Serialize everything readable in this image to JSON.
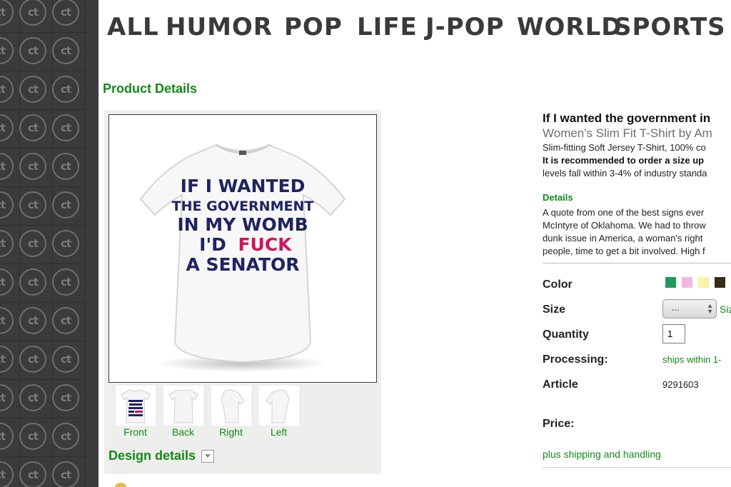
{
  "nav": {
    "items": [
      "ALL",
      "HUMOR",
      "POP",
      "LIFE",
      "J-POP",
      "WORLD",
      "SPORTS"
    ]
  },
  "section_heading": "Product Details",
  "product_image": {
    "shirt_text": [
      "IF I WANTED",
      "THE GOVERNMENT",
      "IN MY WOMB",
      "I'D",
      "FUCK",
      "A SENATOR"
    ]
  },
  "thumbnails": [
    {
      "label": "Front"
    },
    {
      "label": "Back"
    },
    {
      "label": "Right"
    },
    {
      "label": "Left"
    }
  ],
  "design_details": "Design details",
  "product": {
    "title": "If I wanted the government in",
    "subtitle": "Women's Slim Fit T-Shirt by Am",
    "desc_line1": "Slim-fitting Soft Jersey T-Shirt, 100% co",
    "desc_line2": "It is recommended to order a size up",
    "desc_line3": "levels fall within 3-4% of industry standa",
    "details_label": "Details",
    "details_lines": [
      "A quote from one of the best signs ever",
      "McIntyre of Oklahoma. We had to throw",
      "dunk issue in America, a woman's right",
      "people, time to get a bit involved. High f"
    ]
  },
  "options": {
    "color_label": "Color",
    "colors": [
      "#1f9a5a",
      "#f2b8e0",
      "#f8f4a6",
      "#3a2a1a"
    ],
    "size_label": "Size",
    "size_value": "...",
    "size_chart": "Siz",
    "quantity_label": "Quantity",
    "quantity_value": "1",
    "processing_label": "Processing:",
    "processing_value": "ships within 1-",
    "article_label": "Article",
    "article_value": "9291603",
    "price_label": "Price:",
    "shipping": "plus shipping and handling"
  },
  "colors": {
    "accent_green": "#138a18",
    "sidebar": "#3b3b3b",
    "shirt_navy": "#1e2460",
    "shirt_pink": "#d0165b"
  }
}
